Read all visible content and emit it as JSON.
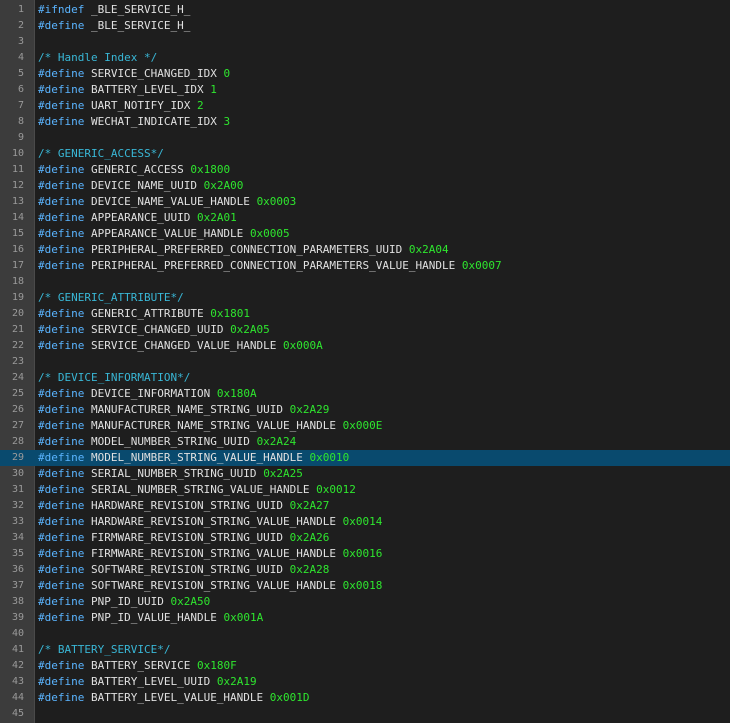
{
  "editor": {
    "colors": {
      "background": "#1e1e1e",
      "gutter": "#3c3c3c",
      "current_line": "#094a6e",
      "keyword": "#5ab4ff",
      "identifier": "#e0e0e0",
      "number": "#2ee62e",
      "comment": "#39b7d6"
    },
    "current_line_number": 29,
    "lines": [
      {
        "n": "1",
        "kw": "#ifndef",
        "id": "_BLE_SERVICE_H_",
        "val": "",
        "comment": ""
      },
      {
        "n": "2",
        "kw": "#define",
        "id": "_BLE_SERVICE_H_",
        "val": "",
        "comment": ""
      },
      {
        "n": "3",
        "kw": "",
        "id": "",
        "val": "",
        "comment": ""
      },
      {
        "n": "4",
        "kw": "",
        "id": "",
        "val": "",
        "comment": "/* Handle Index */"
      },
      {
        "n": "5",
        "kw": "#define",
        "id": "SERVICE_CHANGED_IDX",
        "val": "0",
        "comment": ""
      },
      {
        "n": "6",
        "kw": "#define",
        "id": "BATTERY_LEVEL_IDX",
        "val": "1",
        "comment": ""
      },
      {
        "n": "7",
        "kw": "#define",
        "id": "UART_NOTIFY_IDX",
        "val": "2",
        "comment": ""
      },
      {
        "n": "8",
        "kw": "#define",
        "id": "WECHAT_INDICATE_IDX",
        "val": "3",
        "comment": ""
      },
      {
        "n": "9",
        "kw": "",
        "id": "",
        "val": "",
        "comment": ""
      },
      {
        "n": "10",
        "kw": "",
        "id": "",
        "val": "",
        "comment": "/* GENERIC_ACCESS*/"
      },
      {
        "n": "11",
        "kw": "#define",
        "id": "GENERIC_ACCESS",
        "val": "0x1800",
        "comment": ""
      },
      {
        "n": "12",
        "kw": "#define",
        "id": "DEVICE_NAME_UUID",
        "val": "0x2A00",
        "comment": ""
      },
      {
        "n": "13",
        "kw": "#define",
        "id": "DEVICE_NAME_VALUE_HANDLE",
        "val": "0x0003",
        "comment": ""
      },
      {
        "n": "14",
        "kw": "#define",
        "id": "APPEARANCE_UUID",
        "val": "0x2A01",
        "comment": ""
      },
      {
        "n": "15",
        "kw": "#define",
        "id": "APPEARANCE_VALUE_HANDLE",
        "val": "0x0005",
        "comment": ""
      },
      {
        "n": "16",
        "kw": "#define",
        "id": "PERIPHERAL_PREFERRED_CONNECTION_PARAMETERS_UUID",
        "val": "0x2A04",
        "comment": ""
      },
      {
        "n": "17",
        "kw": "#define",
        "id": "PERIPHERAL_PREFERRED_CONNECTION_PARAMETERS_VALUE_HANDLE",
        "val": "0x0007",
        "comment": ""
      },
      {
        "n": "18",
        "kw": "",
        "id": "",
        "val": "",
        "comment": ""
      },
      {
        "n": "19",
        "kw": "",
        "id": "",
        "val": "",
        "comment": "/* GENERIC_ATTRIBUTE*/"
      },
      {
        "n": "20",
        "kw": "#define",
        "id": "GENERIC_ATTRIBUTE",
        "val": "0x1801",
        "comment": ""
      },
      {
        "n": "21",
        "kw": "#define",
        "id": "SERVICE_CHANGED_UUID",
        "val": "0x2A05",
        "comment": ""
      },
      {
        "n": "22",
        "kw": "#define",
        "id": "SERVICE_CHANGED_VALUE_HANDLE",
        "val": "0x000A",
        "comment": ""
      },
      {
        "n": "23",
        "kw": "",
        "id": "",
        "val": "",
        "comment": ""
      },
      {
        "n": "24",
        "kw": "",
        "id": "",
        "val": "",
        "comment": "/* DEVICE_INFORMATION*/"
      },
      {
        "n": "25",
        "kw": "#define",
        "id": "DEVICE_INFORMATION",
        "val": "0x180A",
        "comment": ""
      },
      {
        "n": "26",
        "kw": "#define",
        "id": "MANUFACTURER_NAME_STRING_UUID",
        "val": "0x2A29",
        "comment": ""
      },
      {
        "n": "27",
        "kw": "#define",
        "id": "MANUFACTURER_NAME_STRING_VALUE_HANDLE",
        "val": "0x000E",
        "comment": ""
      },
      {
        "n": "28",
        "kw": "#define",
        "id": "MODEL_NUMBER_STRING_UUID",
        "val": "0x2A24",
        "comment": ""
      },
      {
        "n": "29",
        "kw": "#define",
        "id": "MODEL_NUMBER_STRING_VALUE_HANDLE",
        "val": "0x0010",
        "comment": ""
      },
      {
        "n": "30",
        "kw": "#define",
        "id": "SERIAL_NUMBER_STRING_UUID",
        "val": "0x2A25",
        "comment": ""
      },
      {
        "n": "31",
        "kw": "#define",
        "id": "SERIAL_NUMBER_STRING_VALUE_HANDLE",
        "val": "0x0012",
        "comment": ""
      },
      {
        "n": "32",
        "kw": "#define",
        "id": "HARDWARE_REVISION_STRING_UUID",
        "val": "0x2A27",
        "comment": ""
      },
      {
        "n": "33",
        "kw": "#define",
        "id": "HARDWARE_REVISION_STRING_VALUE_HANDLE",
        "val": "0x0014",
        "comment": ""
      },
      {
        "n": "34",
        "kw": "#define",
        "id": "FIRMWARE_REVISION_STRING_UUID",
        "val": "0x2A26",
        "comment": ""
      },
      {
        "n": "35",
        "kw": "#define",
        "id": "FIRMWARE_REVISION_STRING_VALUE_HANDLE",
        "val": "0x0016",
        "comment": ""
      },
      {
        "n": "36",
        "kw": "#define",
        "id": "SOFTWARE_REVISION_STRING_UUID",
        "val": "0x2A28",
        "comment": ""
      },
      {
        "n": "37",
        "kw": "#define",
        "id": "SOFTWARE_REVISION_STRING_VALUE_HANDLE",
        "val": "0x0018",
        "comment": ""
      },
      {
        "n": "38",
        "kw": "#define",
        "id": "PNP_ID_UUID",
        "val": "0x2A50",
        "comment": ""
      },
      {
        "n": "39",
        "kw": "#define",
        "id": "PNP_ID_VALUE_HANDLE",
        "val": "0x001A",
        "comment": ""
      },
      {
        "n": "40",
        "kw": "",
        "id": "",
        "val": "",
        "comment": ""
      },
      {
        "n": "41",
        "kw": "",
        "id": "",
        "val": "",
        "comment": "/* BATTERY_SERVICE*/"
      },
      {
        "n": "42",
        "kw": "#define",
        "id": "BATTERY_SERVICE",
        "val": "0x180F",
        "comment": ""
      },
      {
        "n": "43",
        "kw": "#define",
        "id": "BATTERY_LEVEL_UUID",
        "val": "0x2A19",
        "comment": ""
      },
      {
        "n": "44",
        "kw": "#define",
        "id": "BATTERY_LEVEL_VALUE_HANDLE",
        "val": "0x001D",
        "comment": ""
      },
      {
        "n": "45",
        "kw": "",
        "id": "",
        "val": "",
        "comment": ""
      }
    ]
  }
}
